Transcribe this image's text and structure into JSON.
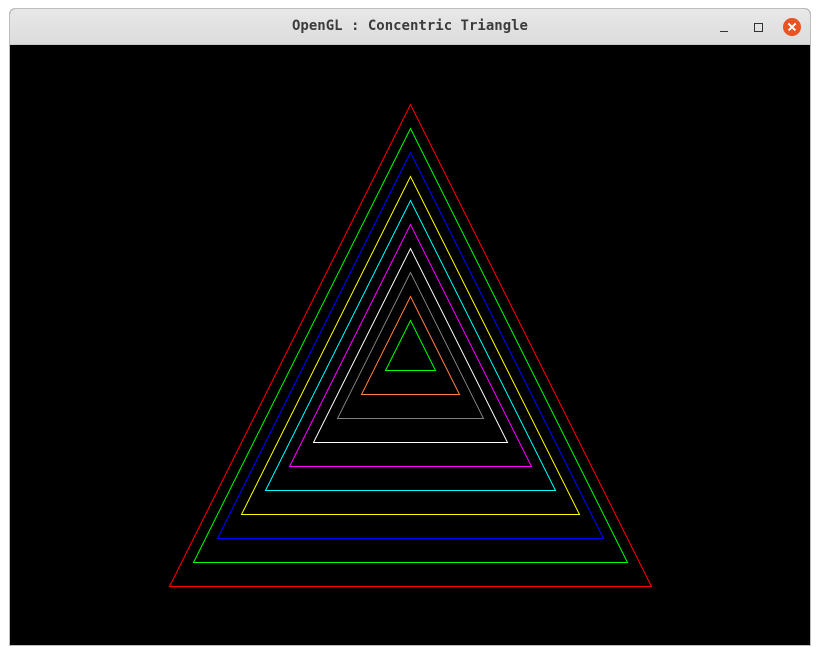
{
  "window": {
    "title": "OpenGL : Concentric Triangle"
  },
  "controls": {
    "minimize_icon": "minimize-icon",
    "maximize_icon": "maximize-icon",
    "close_icon": "close-icon"
  },
  "scene": {
    "background_color": "#000000",
    "triangle_count": 10,
    "triangle_colors": [
      "#ff0000",
      "#00ff00",
      "#0000ff",
      "#ffff00",
      "#00ffff",
      "#ff00ff",
      "#ffffff",
      "#808080",
      "#ff8040",
      "#00ff00"
    ]
  }
}
